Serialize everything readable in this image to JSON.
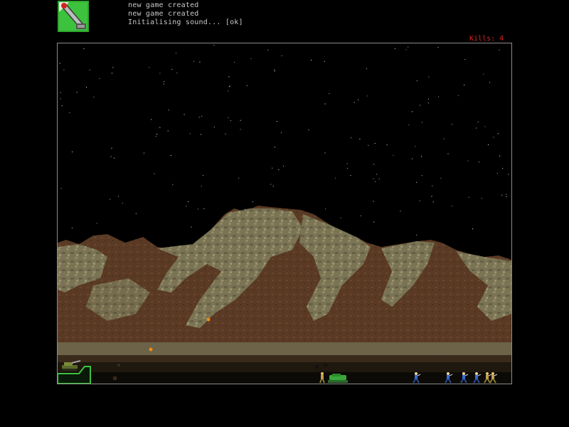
{
  "console": {
    "lines": [
      "new game created",
      "new game created",
      "Initialising sound... [ok]"
    ]
  },
  "hud": {
    "kills_label": "Kills:",
    "kills_value": 4,
    "kills_text": "Kills: 4"
  },
  "icons": {
    "app": "missile-launcher-icon",
    "base": "base-bunker-icon",
    "base_tank": "base-tank-icon",
    "tank": "tank-icon",
    "soldier": "soldier-icon",
    "shell": "shell-icon"
  },
  "colors": {
    "kills": "#e02020",
    "console_text": "#c8c8c8",
    "frame_border": "#8c8c8c",
    "sky": "#000000",
    "rock_light": "#8a8560",
    "rock_mid": "#6e6a4c",
    "dirt": "#5c3a22",
    "ground": "#2a2014",
    "unit_green": "#3aa83a",
    "soldier_blue": "#3a6ad0",
    "shell_orange": "#f08a10"
  },
  "units": {
    "soldiers_right": 6,
    "enemy_tanks": 1,
    "shells_in_flight": 2
  }
}
